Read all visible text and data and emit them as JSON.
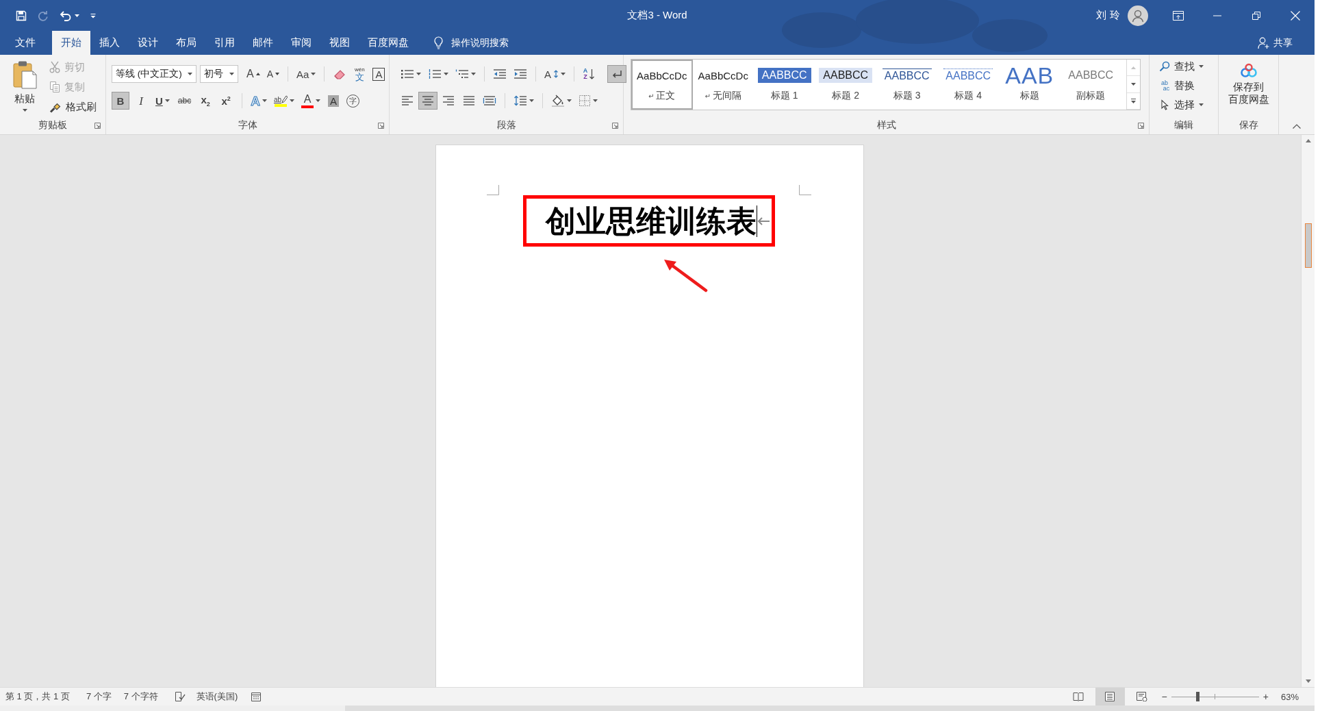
{
  "quick_access": [
    {
      "kind": "save",
      "disabled": false
    },
    {
      "kind": "repeat",
      "disabled": true
    },
    {
      "kind": "undo",
      "disabled": false
    },
    {
      "kind": "customize",
      "disabled": false
    }
  ],
  "window": {
    "title": "文档3 - Word",
    "user": "刘玲"
  },
  "tabs": [
    {
      "label": "文件",
      "selected": false
    },
    {
      "label": "开始",
      "selected": true
    },
    {
      "label": "插入",
      "selected": false
    },
    {
      "label": "设计",
      "selected": false
    },
    {
      "label": "布局",
      "selected": false
    },
    {
      "label": "引用",
      "selected": false
    },
    {
      "label": "邮件",
      "selected": false
    },
    {
      "label": "审阅",
      "selected": false
    },
    {
      "label": "视图",
      "selected": false
    },
    {
      "label": "百度网盘",
      "selected": false
    }
  ],
  "tell_me": {
    "label": "操作说明搜索"
  },
  "share": {
    "label": "共享"
  },
  "clipboard": {
    "title": "剪贴板",
    "paste": "粘贴",
    "items": [
      {
        "kind": "cut",
        "label": "剪切",
        "disabled": true
      },
      {
        "kind": "copy",
        "label": "复制",
        "disabled": true
      },
      {
        "kind": "format_painter",
        "label": "格式刷",
        "disabled": false
      }
    ]
  },
  "font": {
    "title": "字体",
    "font_name": "等线 (中文正文)",
    "font_size": "初号",
    "size_tools": [
      {
        "kind": "grow",
        "label": "A"
      },
      {
        "kind": "shrink",
        "label": "A"
      },
      {
        "kind": "change_case",
        "label": "Aa"
      }
    ],
    "char_tools": [
      {
        "kind": "clear_formatting"
      },
      {
        "kind": "phonetic_guide",
        "label": "文",
        "ruby": "wén"
      },
      {
        "kind": "character_border",
        "label": "A"
      }
    ],
    "toggles": [
      {
        "kind": "bold",
        "label": "B",
        "selected": true
      },
      {
        "kind": "italic",
        "label": "I",
        "selected": false
      },
      {
        "kind": "underline",
        "label": "U",
        "selected": false
      },
      {
        "kind": "strikethrough",
        "label": "abc",
        "selected": false
      },
      {
        "kind": "subscript",
        "label": "x$_{2}$",
        "selected": false
      },
      {
        "kind": "superscript",
        "label": "x$^{2}$",
        "selected": false
      }
    ],
    "color_tools": [
      {
        "kind": "text_effects",
        "label": "A"
      },
      {
        "kind": "highlight",
        "label": "ab",
        "color": "#ffff00"
      },
      {
        "kind": "font_color",
        "label": "A",
        "color": "#ff0000"
      },
      {
        "kind": "shading",
        "label": "A"
      },
      {
        "kind": "enclose",
        "label": "字"
      }
    ]
  },
  "paragraph": {
    "title": "段落",
    "list_tools": [
      {
        "kind": "bullets"
      },
      {
        "kind": "numbering"
      },
      {
        "kind": "multilevel"
      }
    ],
    "indent_tools": [
      {
        "kind": "decrease_indent"
      },
      {
        "kind": "increase_indent"
      }
    ],
    "layout_tool": {
      "kind": "asian_layout",
      "label": "A"
    },
    "sort": {
      "letters": [
        "A",
        "Z"
      ]
    },
    "show_marks": {
      "selected": true
    },
    "alignment": [
      {
        "kind": "left",
        "selected": false
      },
      {
        "kind": "center",
        "selected": true
      },
      {
        "kind": "right",
        "selected": false
      },
      {
        "kind": "justify",
        "selected": false
      },
      {
        "kind": "distributed",
        "selected": false
      }
    ],
    "fill_tools": [
      {
        "kind": "line_spacing"
      },
      {
        "kind": "shading"
      },
      {
        "kind": "borders"
      }
    ]
  },
  "styles": {
    "title": "样式",
    "scroll_up": {
      "disabled": true
    },
    "items": [
      {
        "kind": "normal",
        "sample": "AaBbCcDc",
        "name": "正文",
        "mark": "↵",
        "selected": true
      },
      {
        "kind": "no_spacing",
        "sample": "AaBbCcDc",
        "name": "无间隔",
        "mark": "↵",
        "selected": false
      },
      {
        "kind": "heading_1",
        "sample": "AABBCC",
        "name": "标题 1",
        "selected": false
      },
      {
        "kind": "heading_2",
        "sample": "AABBCC",
        "name": "标题 2",
        "selected": false
      },
      {
        "kind": "heading_3",
        "sample": "AABBCC",
        "name": "标题 3",
        "selected": false
      },
      {
        "kind": "heading_4",
        "sample": "AABBCC",
        "name": "标题 4",
        "selected": false
      },
      {
        "kind": "title",
        "sample": "AAB",
        "name": "标题",
        "selected": false
      },
      {
        "kind": "subtitle",
        "sample": "AABBCC",
        "name": "副标题",
        "selected": false
      }
    ]
  },
  "editing": {
    "title": "编辑",
    "items": [
      {
        "kind": "find",
        "label": "查找"
      },
      {
        "kind": "replace",
        "label": "替换",
        "icon_letters": [
          "ab",
          "ac"
        ]
      },
      {
        "kind": "select",
        "label": "选择"
      }
    ]
  },
  "save": {
    "title": "保存",
    "label_lines": [
      "保存到",
      "百度网盘"
    ]
  },
  "document": {
    "heading": "创业思维训练表"
  },
  "status_bar": {
    "page": "第 1 页，共 1 页",
    "words": "7 个字",
    "characters": "7 个字符",
    "language": "英语(美国)",
    "views": [
      {
        "kind": "read_mode",
        "selected": false
      },
      {
        "kind": "print_layout",
        "selected": true
      },
      {
        "kind": "web_layout",
        "selected": false
      }
    ],
    "zoom_out": "−",
    "zoom_in": "+",
    "zoom": {
      "level": 0.3
    },
    "zoom_reading": "63%"
  }
}
